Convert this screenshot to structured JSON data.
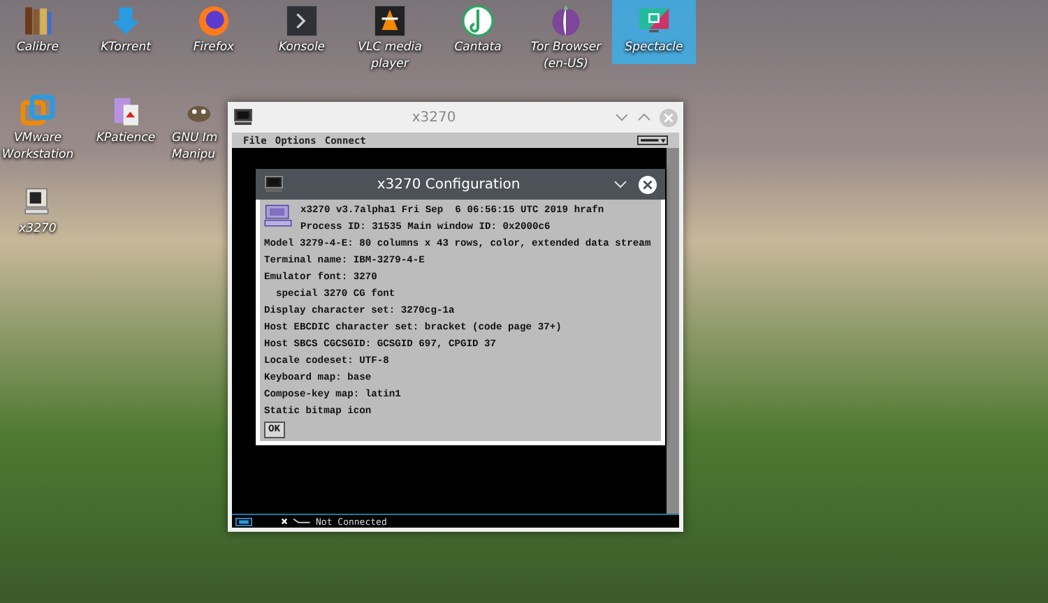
{
  "desktop": {
    "rows": [
      [
        {
          "label": "Calibre",
          "selected": false
        },
        {
          "label": "KTorrent",
          "selected": false
        },
        {
          "label": "Firefox",
          "selected": false
        },
        {
          "label": "Konsole",
          "selected": false
        },
        {
          "label": "VLC media player",
          "selected": false
        },
        {
          "label": "Cantata",
          "selected": false
        },
        {
          "label": "Tor Browser (en-US)",
          "selected": false
        },
        {
          "label": "Spectacle",
          "selected": true
        }
      ],
      [
        {
          "label": "VMware Workstation",
          "selected": false
        },
        {
          "label": "KPatience",
          "selected": false
        },
        {
          "label": "GNU Im\nManipu",
          "selected": false
        }
      ],
      [
        {
          "label": "x3270",
          "selected": false
        }
      ]
    ]
  },
  "window": {
    "title": "x3270",
    "menu": [
      "File",
      "Options",
      "Connect"
    ],
    "status": "Not Connected"
  },
  "dialog": {
    "title": "x3270 Configuration",
    "header_lines": [
      "x3270 v3.7alpha1 Fri Sep  6 06:56:15 UTC 2019 hrafn",
      "Process ID: 31535 Main window ID: 0x2000c6"
    ],
    "lines": [
      "Model 3279-4-E: 80 columns x 43 rows, color, extended data stream",
      "Terminal name: IBM-3279-4-E",
      "Emulator font: 3270",
      "  special 3270 CG font",
      "Display character set: 3270cg-1a",
      "Host EBCDIC character set: bracket (code page 37+)",
      "Host SBCS CGCSGID: GCSGID 697, CPGID 37",
      "Locale codeset: UTF-8",
      "Keyboard map: base",
      "Compose-key map: latin1",
      "Static bitmap icon"
    ],
    "button": "OK"
  }
}
